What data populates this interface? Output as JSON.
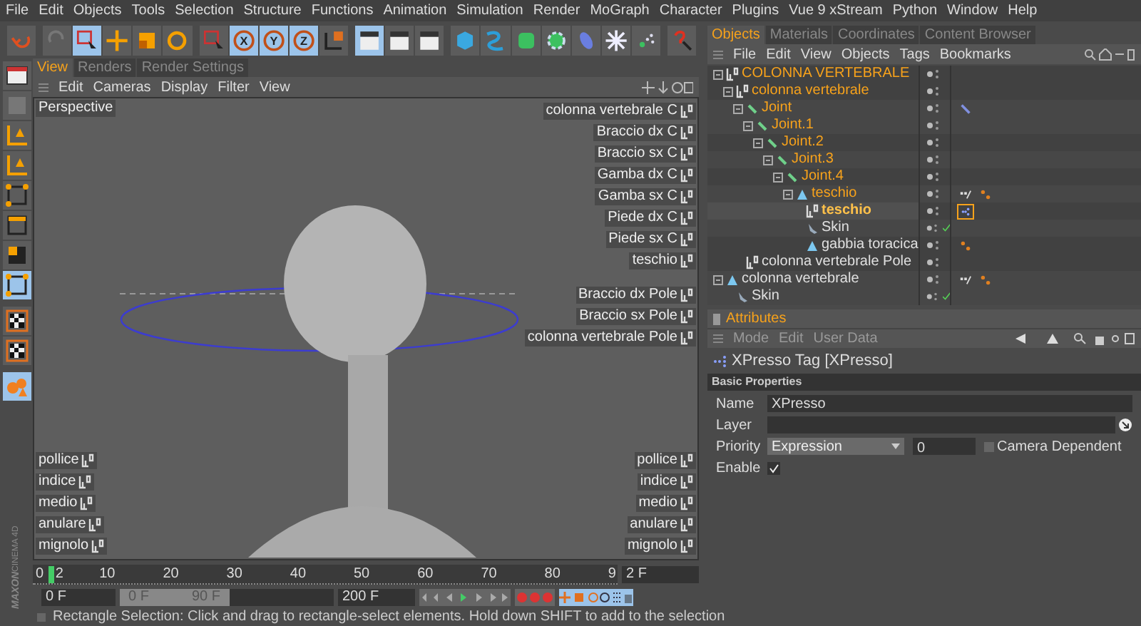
{
  "menu_bar": [
    "File",
    "Edit",
    "Objects",
    "Tools",
    "Selection",
    "Structure",
    "Functions",
    "Animation",
    "Simulation",
    "Render",
    "MoGraph",
    "Character",
    "Plugins",
    "Vue 9 xStream",
    "Python",
    "Window",
    "Help"
  ],
  "toolbar": [
    {
      "kind": "undo",
      "selected": false
    },
    {
      "kind": "redo",
      "selected": false
    },
    {
      "kind": "select",
      "selected": true
    },
    {
      "kind": "move",
      "selected": false
    },
    {
      "kind": "scale",
      "selected": false
    },
    {
      "kind": "rotate",
      "selected": false
    },
    {
      "kind": "select",
      "selected": false
    },
    {
      "kind": "x",
      "label": "X",
      "selected": true
    },
    {
      "kind": "y",
      "label": "Y",
      "selected": true
    },
    {
      "kind": "z",
      "label": "Z",
      "selected": true
    },
    {
      "kind": "coords",
      "selected": false
    },
    {
      "kind": "clapper",
      "selected": true
    },
    {
      "kind": "clapper",
      "selected": false
    },
    {
      "kind": "clapper",
      "selected": false
    },
    {
      "kind": "cube",
      "selected": false
    },
    {
      "kind": "spline",
      "selected": false
    },
    {
      "kind": "nurbs",
      "selected": false
    },
    {
      "kind": "array",
      "selected": false
    },
    {
      "kind": "deformer",
      "selected": false
    },
    {
      "kind": "scene",
      "selected": false
    },
    {
      "kind": "particles",
      "selected": false
    },
    {
      "kind": "help",
      "selected": false
    }
  ],
  "left_toolbar": [
    {
      "kind": "layout",
      "selected": false
    },
    {
      "kind": "blank",
      "selected": false
    },
    {
      "kind": "axis",
      "selected": false
    },
    {
      "kind": "axis",
      "selected": false
    },
    {
      "kind": "points",
      "selected": false
    },
    {
      "kind": "edges",
      "selected": false
    },
    {
      "kind": "polygons",
      "selected": false
    },
    {
      "kind": "points",
      "selected": true
    },
    {
      "kind": "checker",
      "on": true
    },
    {
      "kind": "checker",
      "on": true
    },
    {
      "kind": "spheres",
      "selected": true
    }
  ],
  "viewport": {
    "tabs": [
      {
        "label": "View",
        "selected": true
      },
      {
        "label": "Renders",
        "selected": false
      },
      {
        "label": "Render Settings",
        "selected": false
      }
    ],
    "menu": [
      "Edit",
      "Cameras",
      "Display",
      "Filter",
      "View"
    ],
    "camera": "Perspective",
    "labels_top_right": [
      "colonna vertebrale C",
      "Braccio dx C",
      "Braccio sx C",
      "Gamba dx C",
      "Gamba sx C",
      "Piede dx C",
      "Piede sx C",
      "teschio"
    ],
    "labels_mid_right": [
      "Braccio dx Pole",
      "Braccio sx Pole",
      "colonna vertebrale Pole"
    ],
    "labels_bottom_left": [
      "pollice",
      "indice",
      "medio",
      "anulare",
      "mignolo"
    ],
    "labels_bottom_right": [
      "pollice",
      "indice",
      "medio",
      "anulare",
      "mignolo"
    ]
  },
  "timeline": {
    "ruler": [
      "0",
      "10",
      "20",
      "30",
      "40",
      "50",
      "60",
      "70",
      "80",
      "9"
    ],
    "current_frame": {
      "label": "2",
      "level": 0.022
    },
    "current_field": "2 F",
    "start_field": "0 F",
    "range": {
      "start": "0 F",
      "end": "90 F",
      "level": 0.51
    },
    "end_field": "200 F"
  },
  "brand": [
    "MAXON",
    "CINEMA 4D"
  ],
  "status_bar": "Rectangle Selection: Click and drag to rectangle-select elements. Hold down SHIFT to add to the selection",
  "objects_panel": {
    "tabs": [
      {
        "label": "Objects",
        "selected": true
      },
      {
        "label": "Materials",
        "selected": false
      },
      {
        "label": "Coordinates",
        "selected": false
      },
      {
        "label": "Content Browser",
        "selected": false
      }
    ],
    "menu": [
      "File",
      "Edit",
      "View",
      "Objects",
      "Tags",
      "Bookmarks"
    ],
    "tree": [
      {
        "name": "COLONNA VERTEBRALE",
        "kind": "null",
        "selected": true,
        "current": false,
        "children": [
          {
            "name": "colonna vertebrale",
            "kind": "null",
            "selected": true,
            "current": false,
            "children": [
              {
                "name": "Joint",
                "kind": "joint",
                "selected": true,
                "current": false,
                "tags": [
                  {
                    "kind": "ik",
                    "selected": false
                  }
                ],
                "children": [
                  {
                    "name": "Joint.1",
                    "kind": "joint",
                    "selected": true,
                    "current": false,
                    "children": [
                      {
                        "name": "Joint.2",
                        "kind": "joint",
                        "selected": true,
                        "current": false,
                        "children": [
                          {
                            "name": "Joint.3",
                            "kind": "joint",
                            "selected": true,
                            "current": false,
                            "children": [
                              {
                                "name": "Joint.4",
                                "kind": "joint",
                                "selected": true,
                                "current": false,
                                "children": [
                                  {
                                    "name": "teschio",
                                    "kind": "polygon",
                                    "selected": true,
                                    "current": false,
                                    "tags": [
                                      {
                                        "kind": "weight",
                                        "selected": false
                                      },
                                      {
                                        "kind": "points",
                                        "selected": false
                                      }
                                    ],
                                    "children": [
                                      {
                                        "name": "teschio",
                                        "kind": "null",
                                        "selected": true,
                                        "current": true,
                                        "tags": [
                                          {
                                            "kind": "xpresso",
                                            "selected": true
                                          }
                                        ]
                                      },
                                      {
                                        "name": "Skin",
                                        "kind": "skin",
                                        "selected": false,
                                        "current": false
                                      },
                                      {
                                        "name": "gabbia toracica",
                                        "kind": "polygon",
                                        "selected": false,
                                        "current": false,
                                        "tags": [
                                          {
                                            "kind": "points",
                                            "selected": false
                                          }
                                        ]
                                      }
                                    ]
                                  }
                                ]
                              }
                            ]
                          }
                        ]
                      }
                    ]
                  }
                ]
              },
              {
                "name": "colonna vertebrale Pole",
                "kind": "null",
                "selected": false,
                "current": false
              }
            ]
          }
        ]
      },
      {
        "name": "colonna vertebrale",
        "kind": "polygon",
        "selected": false,
        "current": false,
        "tags": [
          {
            "kind": "weight",
            "selected": false
          },
          {
            "kind": "points",
            "selected": false
          }
        ],
        "children": [
          {
            "name": "Skin",
            "kind": "skin",
            "selected": false,
            "current": false
          }
        ]
      }
    ]
  },
  "attributes": {
    "title": "Attributes",
    "menu": [
      "Mode",
      "Edit",
      "User Data"
    ],
    "object": "XPresso Tag [XPresso]",
    "section": "Basic Properties",
    "fields": [
      {
        "kind": "text",
        "label": "Name",
        "value": "XPresso"
      },
      {
        "kind": "link",
        "label": "Layer"
      },
      {
        "kind": "priority",
        "label": "Priority",
        "value": "Expression",
        "number": "0",
        "checkbox_label": "Camera Dependent",
        "checked": false
      },
      {
        "kind": "check",
        "label": "Enable",
        "checked": true
      }
    ]
  }
}
